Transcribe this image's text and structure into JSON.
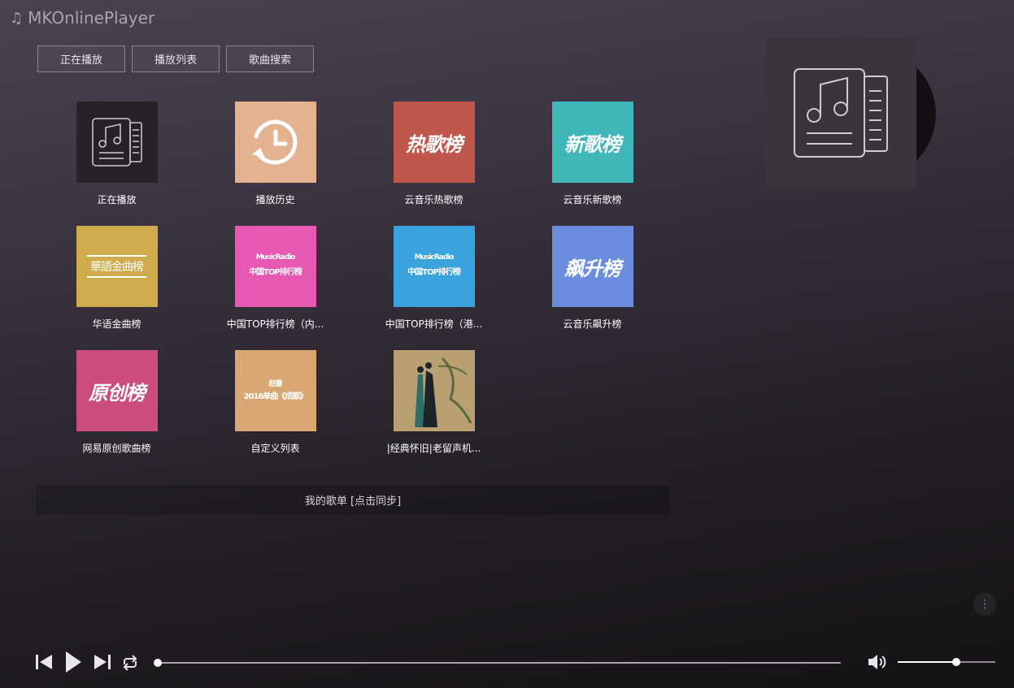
{
  "app": {
    "title": "MKOnlinePlayer",
    "logo_icon": "music-note-icon"
  },
  "tabs": [
    {
      "label": "正在播放"
    },
    {
      "label": "播放列表"
    },
    {
      "label": "歌曲搜索"
    }
  ],
  "playlists": [
    {
      "label": "正在播放",
      "cover_text": "",
      "bg": "#262227",
      "icon": "playlist-doc-icon"
    },
    {
      "label": "播放历史",
      "cover_text": "",
      "bg": "#e3b28f",
      "icon": "history-icon"
    },
    {
      "label": "云音乐热歌榜",
      "cover_text": "热歌榜",
      "bg": "#c0574d"
    },
    {
      "label": "云音乐新歌榜",
      "cover_text": "新歌榜",
      "bg": "#3fb6ba"
    },
    {
      "label": "华语金曲榜",
      "cover_text": "華語金曲榜",
      "bg": "#cfab4c"
    },
    {
      "label": "中国TOP排行榜（内...",
      "cover_text": "MusicRadio",
      "cover_text2": "中国TOP排行榜",
      "bg": "#e658b2"
    },
    {
      "label": "中国TOP排行榜（港...",
      "cover_text": "MusicRadio",
      "cover_text2": "中国TOP排行榜",
      "bg": "#3aa3dd"
    },
    {
      "label": "云音乐飙升榜",
      "cover_text": "飙升榜",
      "bg": "#6c8ddd"
    },
    {
      "label": "网易原创歌曲榜",
      "cover_text": "原创榜",
      "bg": "#cd4d7c"
    },
    {
      "label": "自定义列表",
      "cover_text": "赵雷",
      "cover_text2": "2016单曲《成都》",
      "bg": "#d9a872"
    },
    {
      "label": "|经典怀旧|老留声机...",
      "cover_text": "",
      "bg": "#b8a073"
    }
  ],
  "sync": {
    "label": "我的歌单 [点击同步]"
  },
  "album": {
    "icon": "playlist-doc-icon"
  },
  "controls": {
    "prev_icon": "skip-previous-icon",
    "play_icon": "play-icon",
    "next_icon": "skip-next-icon",
    "loop_icon": "loop-icon",
    "volume_icon": "volume-icon",
    "more_icon": "more-vertical-icon",
    "more_glyph": "⋮",
    "progress": 0.0,
    "volume": 0.6
  },
  "colors": {
    "accent": "#ffffff",
    "muted": "#a9a3ae"
  }
}
